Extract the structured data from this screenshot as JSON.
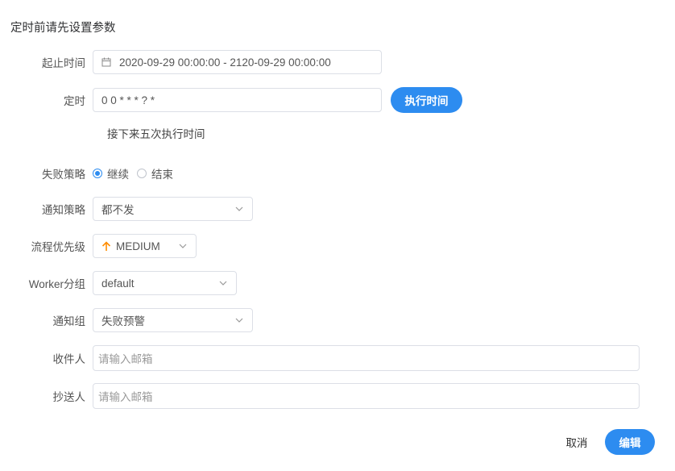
{
  "title": "定时前请先设置参数",
  "form": {
    "time_range": {
      "label": "起止时间",
      "value": "2020-09-29 00:00:00 - 2120-09-29 00:00:00"
    },
    "crontab": {
      "label": "定时",
      "value": "0 0 * * * ? *",
      "exec_button": "执行时间",
      "next_five_label": "接下来五次执行时间"
    },
    "failure_strategy": {
      "label": "失败策略",
      "options": [
        "继续",
        "结束"
      ],
      "selected": "继续"
    },
    "notify_strategy": {
      "label": "通知策略",
      "value": "都不发"
    },
    "priority": {
      "label": "流程优先级",
      "value": "MEDIUM",
      "icon": "arrow-up-icon",
      "color": "#ff8c00"
    },
    "worker_group": {
      "label": "Worker分组",
      "value": "default"
    },
    "notify_group": {
      "label": "通知组",
      "value": "失败预警"
    },
    "receivers": {
      "label": "收件人",
      "placeholder": "请输入邮箱"
    },
    "cc": {
      "label": "抄送人",
      "placeholder": "请输入邮箱"
    }
  },
  "footer": {
    "cancel": "取消",
    "edit": "编辑"
  },
  "colors": {
    "primary": "#2d8cf0",
    "border": "#dcdfe6"
  }
}
